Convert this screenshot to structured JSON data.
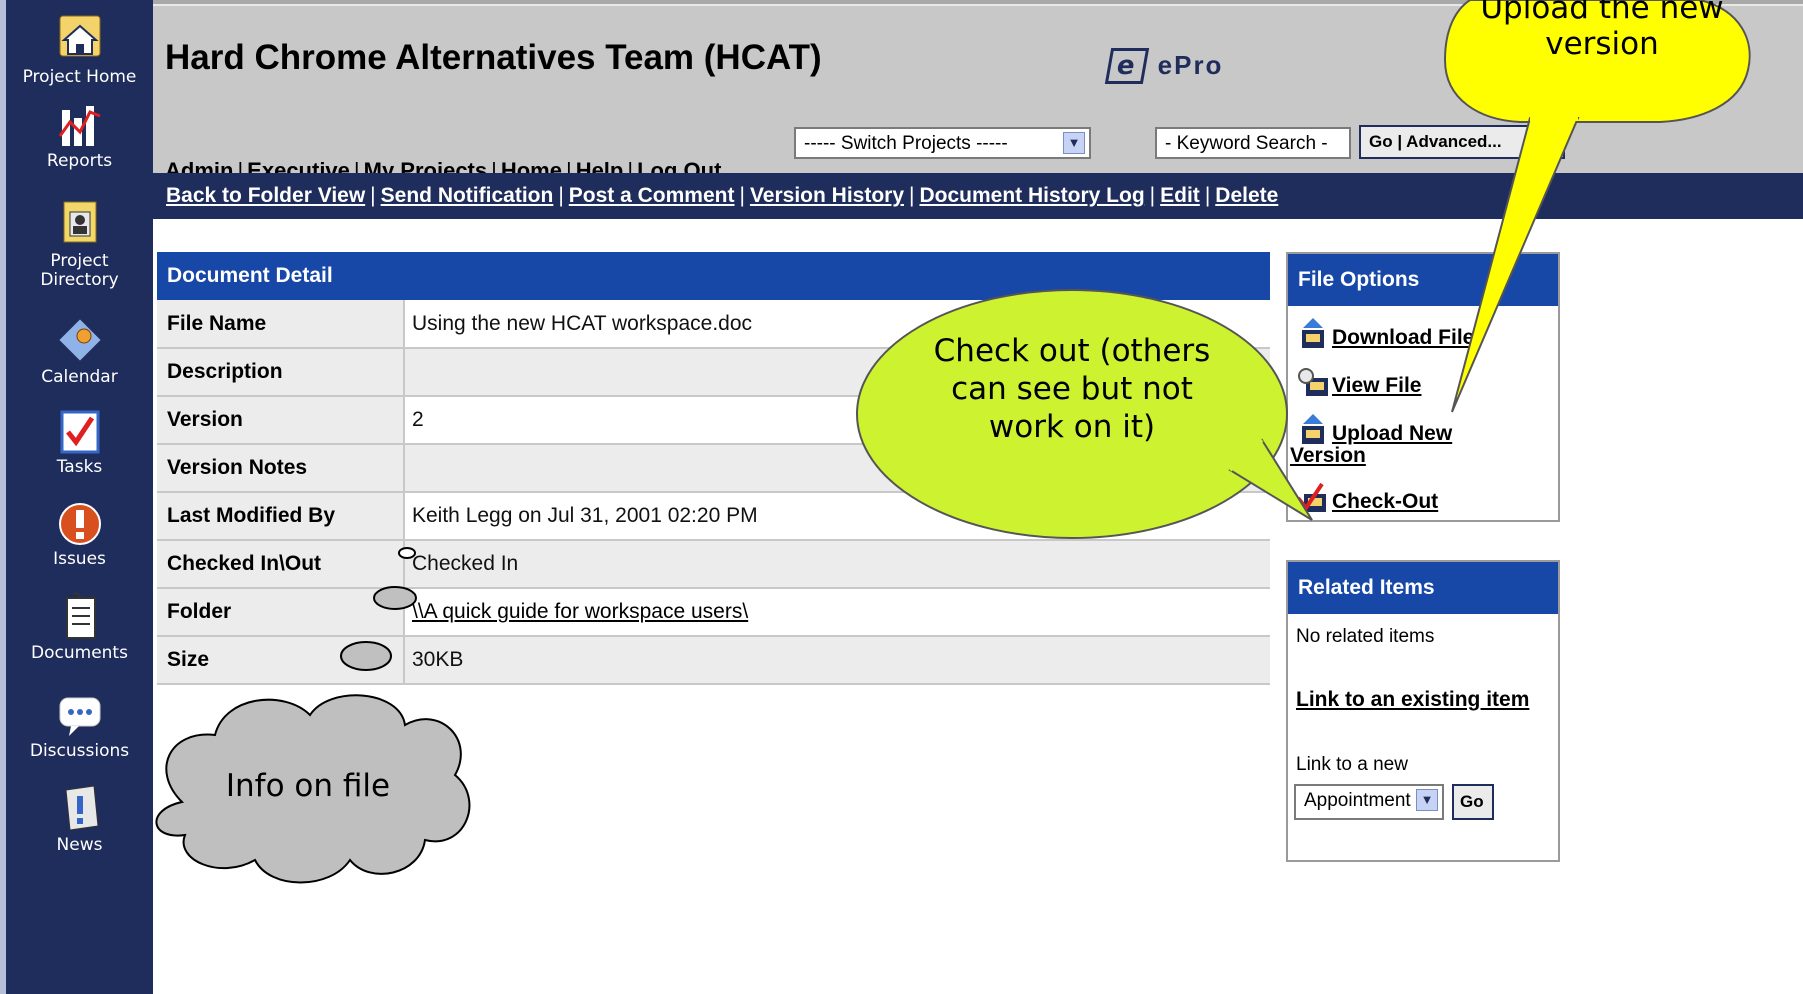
{
  "leftnav": {
    "items": [
      {
        "label": "Project Home",
        "icon": "house-folder-icon"
      },
      {
        "label": "Reports",
        "icon": "chart-icon"
      },
      {
        "label": "Project",
        "label2": "Directory",
        "icon": "directory-icon"
      },
      {
        "label": "Calendar",
        "icon": "calendar-icon"
      },
      {
        "label": "Tasks",
        "icon": "checkmark-icon"
      },
      {
        "label": "Issues",
        "icon": "exclamation-icon"
      },
      {
        "label": "Documents",
        "icon": "document-icon"
      },
      {
        "label": "Discussions",
        "icon": "speech-bubble-icon"
      },
      {
        "label": "News",
        "icon": "newspaper-icon"
      }
    ]
  },
  "header": {
    "title": "Hard Chrome Alternatives Team (HCAT)",
    "logo_text": "ePro",
    "nav": [
      "Admin",
      "Executive",
      "My Projects",
      "Home",
      "Help",
      "Log Out"
    ],
    "switch_projects": "----- Switch Projects -----",
    "keyword_search": "- Keyword Search -",
    "advanced_button": "Go | Advanced..."
  },
  "actionbar": {
    "links": [
      "Back to Folder View",
      "Send Notification",
      "Post a Comment",
      "Version History",
      "Document History Log",
      "Edit",
      "Delete"
    ]
  },
  "detail": {
    "heading": "Document Detail",
    "rows": [
      {
        "key": "File Name",
        "value": "Using the new HCAT workspace.doc"
      },
      {
        "key": "Description",
        "value": ""
      },
      {
        "key": "Version",
        "value": "2"
      },
      {
        "key": "Version Notes",
        "value": ""
      },
      {
        "key": "Last Modified By",
        "value": "Keith Legg on Jul 31, 2001 02:20 PM"
      },
      {
        "key": "Checked In\\Out",
        "value": "Checked In"
      },
      {
        "key": "Folder",
        "value": "\\\\A quick guide for workspace users\\"
      },
      {
        "key": "Size",
        "value": "30KB"
      }
    ]
  },
  "file_options": {
    "heading": "File Options",
    "download": "Download File",
    "view": "View File",
    "upload": "Upload New",
    "upload2": "Version",
    "checkout": "Check-Out"
  },
  "related": {
    "heading": "Related Items",
    "none": "No related items",
    "link_existing": "Link to an existing item",
    "link_new": "Link to a new",
    "select_value": "Appointment",
    "go": "Go"
  },
  "callouts": {
    "upload": "Upload the new version",
    "checkout": "Check out (others can see but not work on it)",
    "info": "Info on file"
  },
  "colors": {
    "nav_bg": "#1f2d5c",
    "panel_head": "#1748a8",
    "callout_yellow": "#ffff00",
    "callout_green": "#ccf230",
    "cloud_gray": "#bfbfbf"
  }
}
